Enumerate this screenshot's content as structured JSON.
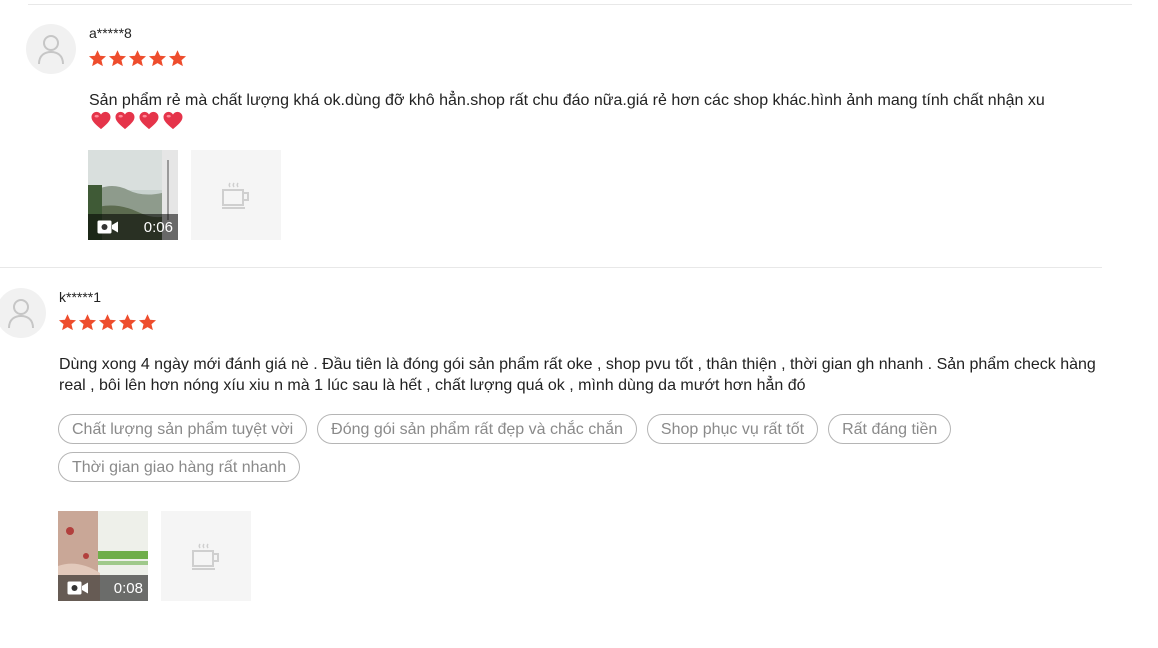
{
  "reviews": [
    {
      "username": "a*****8",
      "rating": 5,
      "comment": "Sản phẩm rẻ mà chất lượng khá ok.dùng đỡ khô hẳn.shop rất chu đáo nữa.giá rẻ hơn các shop khác.hình ảnh mang tính chất nhận xu",
      "heart_emoji_count": 4,
      "tags": [],
      "video_duration": "0:06"
    },
    {
      "username": "k*****1",
      "rating": 5,
      "comment": "Dùng xong 4 ngày mới đánh giá nè . Đầu tiên là đóng gói sản phẩm rất oke , shop pvu tốt , thân thiện , thời gian gh nhanh . Sản phẩm check hàng real , bôi lên hơn nóng xíu xiu n mà 1 lúc sau là hết , chất lượng quá ok , mình dùng da mướt hơn hẳn đó",
      "tags": [
        "Chất lượng sản phẩm tuyệt vời",
        "Đóng gói sản phẩm rất đẹp và chắc chắn",
        "Shop phục vụ rất tốt",
        "Rất đáng tiền",
        "Thời gian giao hàng rất nhanh"
      ],
      "video_duration": "0:08"
    }
  ],
  "colors": {
    "star": "#ee4d2d",
    "heart": "#e5344a",
    "tag_border": "#b5b5b5",
    "tag_text": "#8a8a8a"
  }
}
